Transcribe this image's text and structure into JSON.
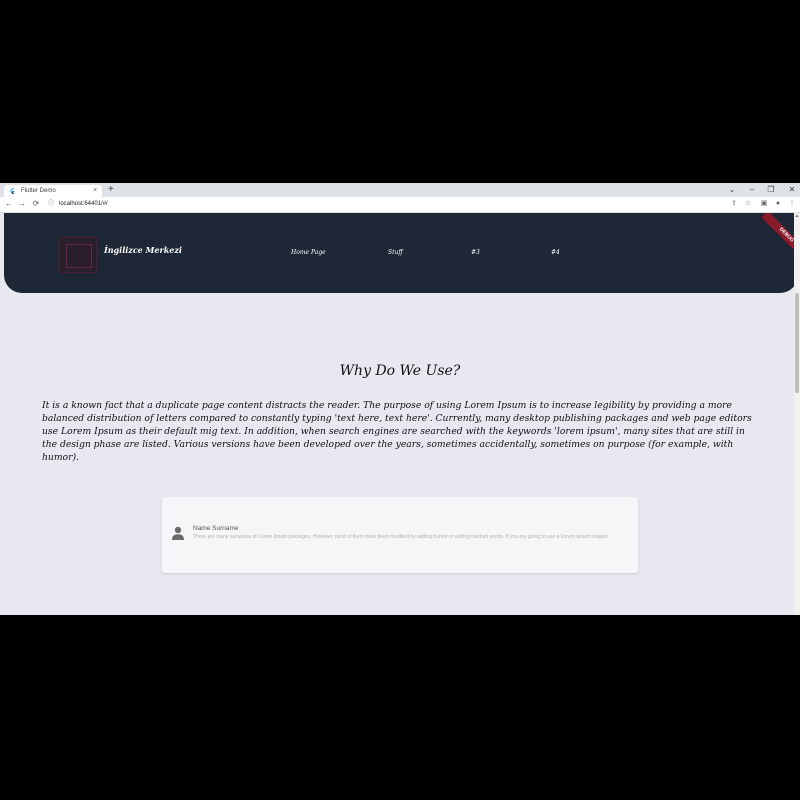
{
  "browser": {
    "tab_title": "Flutter Demo",
    "tab_close": "×",
    "new_tab": "+",
    "window_controls": {
      "menu": "⌄",
      "minimize": "–",
      "restore": "❐",
      "close": "✕"
    },
    "nav": {
      "back": "←",
      "forward": "→",
      "reload": "⟳"
    },
    "url_info_icon": "ⓘ",
    "url": "localhost:64401/#/",
    "toolbar_icons": {
      "share": "⇪",
      "star": "☆",
      "sidebar": "▣",
      "profile": "●",
      "menu": "⋮"
    }
  },
  "header": {
    "brand": "İngilizce Merkezi",
    "nav": [
      "Home Page",
      "Stuff",
      "#3",
      "#4"
    ],
    "debug_banner": "DEBUG"
  },
  "main": {
    "title": "Why Do We Use?",
    "paragraph": "It is a known fact that a duplicate page content distracts the reader. The purpose of using Lorem Ipsum is to increase legibility by providing a more balanced distribution of letters compared to constantly typing 'text here, text here'. Currently, many desktop publishing packages and web page editors use Lorem Ipsum as their default mig text. In addition, when search engines are searched with the keywords 'lorem ipsum', many sites that are still in the design phase are listed. Various versions have been developed over the years, sometimes accidentally, sometimes on purpose (for example, with humor)."
  },
  "testimonial": {
    "icon": "person-icon",
    "name": "Name Surname",
    "text": "There are many variations of Lorem Ipsum passages. However, most of them have been modified by adding humor or adding random words. If you are going to use a Lorem Ipsum snippet,"
  },
  "colors": {
    "header_bg": "#1e2735",
    "page_bg": "#e8e8f0",
    "card_bg": "#f6f6f8",
    "debug_ribbon": "#8b1a2b"
  }
}
